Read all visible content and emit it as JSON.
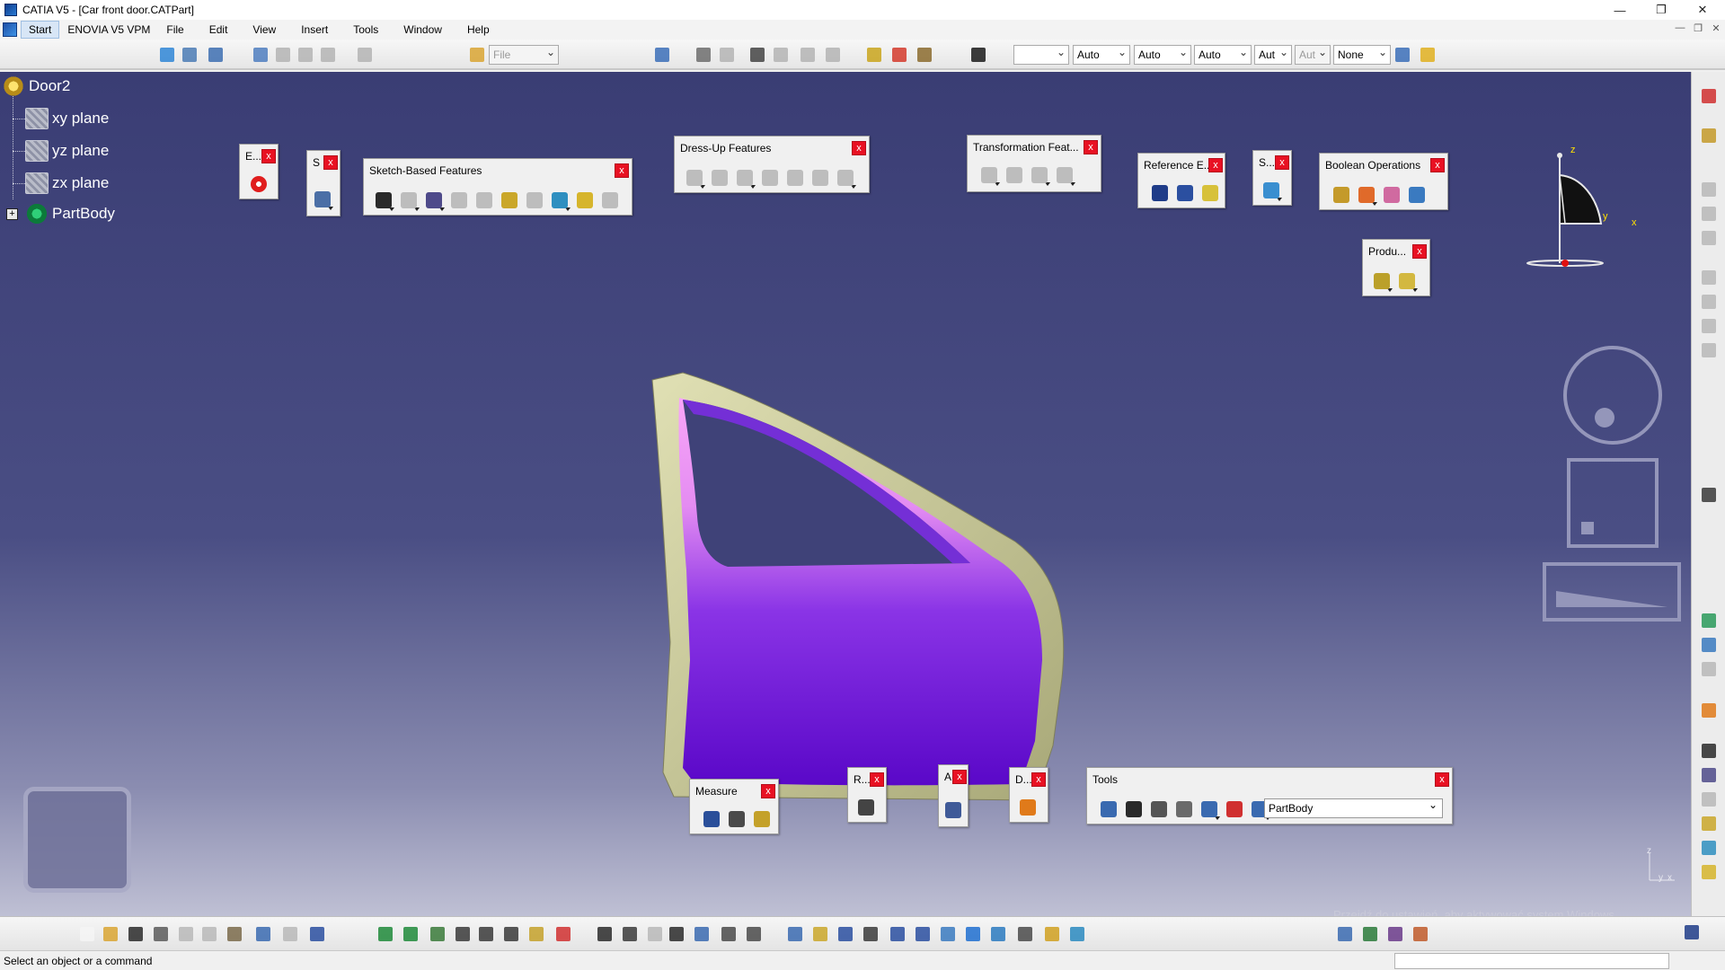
{
  "window": {
    "title": "CATIA V5 - [Car front door.CATPart]",
    "controls": [
      "—",
      "❐",
      "✕"
    ],
    "mdi_controls": [
      "—",
      "❐",
      "✕"
    ]
  },
  "menu": {
    "items": [
      "Start",
      "ENOVIA V5 VPM",
      "File",
      "Edit",
      "View",
      "Insert",
      "Tools",
      "Window",
      "Help"
    ]
  },
  "toolbar": {
    "file_combo": "File",
    "combos": [
      "",
      "Auto",
      "Auto",
      "Auto",
      "Aut",
      "Aut",
      "None"
    ]
  },
  "tree": {
    "root": "Door2",
    "items": [
      "xy plane",
      "yz plane",
      "zx plane",
      "PartBody"
    ]
  },
  "floating_toolbars": {
    "e": "E...",
    "s1": "S",
    "sketch": "Sketch-Based Features",
    "dressup": "Dress-Up Features",
    "transform": "Transformation Feat...",
    "reference": "Reference E...",
    "s2": "S...",
    "boolean": "Boolean Operations",
    "produ": "Produ...",
    "measure": "Measure",
    "r": "R...",
    "a": "A",
    "d": "D...",
    "tools": "Tools",
    "tools_select": "PartBody",
    "close": "x"
  },
  "compass": {
    "z": "z",
    "x": "x",
    "y": "y"
  },
  "corner_axis": {
    "z": "z",
    "y": "y",
    "x": "x"
  },
  "watermark": "Przejdź do ustawień, aby aktywować system Windows.",
  "status": {
    "message": "Select an object or a command",
    "command_input": ""
  },
  "colors": {
    "viewport_top": "#3a3d74",
    "viewport_bottom": "#bfc0d4",
    "door_purple": "#6a10d6",
    "door_pink": "#f39cf5",
    "door_frame": "#c9c99a",
    "close_button": "#e81123"
  }
}
